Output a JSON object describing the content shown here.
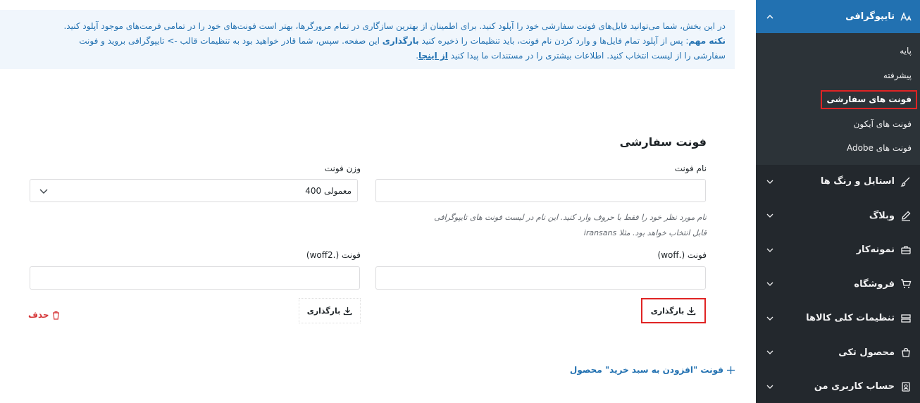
{
  "sidebar": {
    "active_section": {
      "label": "تایپوگرافی",
      "icon": "typography-icon",
      "sub_items": [
        {
          "label": "پایه",
          "active": false
        },
        {
          "label": "پیشرفته",
          "active": false
        },
        {
          "label": "فونت های سفارشی",
          "active": true
        },
        {
          "label": "فونت های آیکون",
          "active": false
        },
        {
          "label": "فونت های Adobe",
          "active": false
        }
      ]
    },
    "items": [
      {
        "label": "استایل و رنگ ها",
        "icon": "brush-icon"
      },
      {
        "label": "وبلاگ",
        "icon": "pencil-icon"
      },
      {
        "label": "نمونه‌کار",
        "icon": "briefcase-icon"
      },
      {
        "label": "فروشگاه",
        "icon": "cart-icon"
      },
      {
        "label": "تنظیمات کلی کالاها",
        "icon": "stack-icon"
      },
      {
        "label": "محصول تکی",
        "icon": "bag-icon"
      },
      {
        "label": "حساب کاربری من",
        "icon": "user-icon"
      }
    ]
  },
  "notice": {
    "line1": "در این بخش، شما می‌توانید فایل‌های فونت سفارشی خود را آپلود کنید. برای اطمینان از بهترین سازگاری در تمام مرورگرها، بهتر است فونت‌های خود را در تمامی فرمت‌های موجود آپلود کنید.",
    "important": "نکته مهم",
    "line2a": ": پس از آپلود تمام فایل‌ها و وارد کردن نام فونت، باید تنظیمات را ذخیره کنید",
    "reload": "بارگذاری",
    "line2b": "این صفحه. سپس، شما قادر خواهید بود به تنظیمات قالب -> تایپوگرافی بروید و فونت",
    "line3": "سفارشی را از لیست انتخاب کنید. اطلاعات بیشتری را در مستندات ما پیدا کنید",
    "link": "از اینجا"
  },
  "section": {
    "title": "فونت سفارشی",
    "font_name_label": "نام فونت",
    "font_name_value": "",
    "font_weight_label": "وزن فونت",
    "font_weight_value": "معمولی 400",
    "desc_line1": "نام مورد نظر خود را فقط با حروف وارد کنید. این نام در لیست فونت های تایپوگرافی",
    "desc_line2": "قابل انتخاب خواهد بود. مثلا iransans",
    "woff_label": "فونت (.woff)",
    "woff2_label": "فونت (.woff2)",
    "upload_label": "بارگذاری",
    "delete_label": "حذف",
    "add_label": "فونت \"افزودن به سبد خرید\" محصول"
  },
  "colors": {
    "accent": "#2271b1",
    "sidebar_bg": "#23282d",
    "highlight": "#e02424",
    "danger": "#d63638"
  }
}
